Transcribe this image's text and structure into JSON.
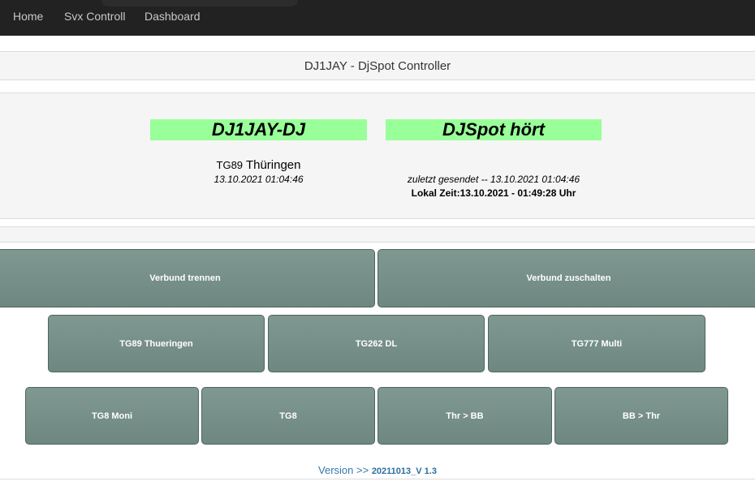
{
  "nav": {
    "items": [
      "Home",
      "Svx Controll",
      "Dashboard"
    ]
  },
  "title": "DJ1JAY - DjSpot Controller",
  "status": {
    "left_callsign": "DJ1JAY-DJ",
    "left_tg_prefix": "TG89",
    "left_tg_name": "Thüringen",
    "left_time": "13.10.2021 01:04:46",
    "right_status": "DJSpot hört",
    "right_last_sent": "zuletzt gesendet -- 13.10.2021 01:04:46",
    "right_local_time": "Lokal Zeit:13.10.2021 - 01:49:28 Uhr"
  },
  "buttons": {
    "row1": [
      "Verbund trennen",
      "Verbund zuschalten"
    ],
    "row2": [
      "TG89 Thueringen",
      "TG262 DL",
      "TG777 Multi"
    ],
    "row3": [
      "TG8 Moni",
      "TG8",
      "Thr > BB",
      "BB > Thr"
    ]
  },
  "version": {
    "label": "Version >>",
    "number": "20211013_V 1.3"
  },
  "colors": {
    "navbar": "#222222",
    "status_green": "#99ff99",
    "button": "#7a928c",
    "version_link": "#3777a8"
  }
}
